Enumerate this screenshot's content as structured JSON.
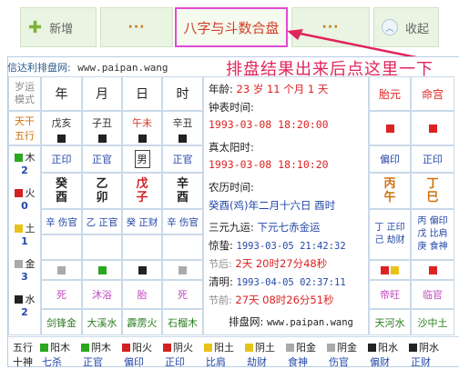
{
  "toolbar": {
    "add_label": "新增",
    "dots1": "···",
    "main_tab": "八字与斗数合盘",
    "dots2": "···",
    "fold_label": "收起"
  },
  "header": {
    "site_label": "信达利排盘网:",
    "site_url": "www.paipan.wang",
    "callout": "排盘结果出来后点这里一下"
  },
  "left_col": {
    "yunshi": "岁运模式",
    "tiangan": "天干",
    "wuxing": "五行",
    "elements": [
      {
        "name": "木",
        "count": "2",
        "color": "#2aa81f"
      },
      {
        "name": "火",
        "count": "0",
        "color": "#d22222"
      },
      {
        "name": "土",
        "count": "1",
        "color": "#e8c21a"
      },
      {
        "name": "金",
        "count": "3",
        "color": "#aaaaaa"
      },
      {
        "name": "水",
        "count": "2",
        "color": "#222222"
      }
    ]
  },
  "pillars": {
    "headers": [
      "年",
      "月",
      "日",
      "时"
    ],
    "sub": [
      "戊亥",
      "子丑",
      "午未",
      "辛丑"
    ],
    "sub_colors": [
      "#333333",
      "#333333",
      "#d63c27",
      "#333333"
    ],
    "gods": [
      "正印",
      "正官",
      "男",
      "正官"
    ],
    "stems": [
      "癸",
      "乙",
      "戊",
      "辛"
    ],
    "branches": [
      "酉",
      "卯",
      "子",
      "酉"
    ],
    "stem_colors": [
      "#222222",
      "#222222",
      "#d22222",
      "#222222"
    ],
    "hidden": [
      "辛 伤官",
      "乙 正官",
      "癸 正财",
      "辛 伤官"
    ],
    "states": [
      "死",
      "沐浴",
      "胎",
      "死"
    ],
    "nayin": [
      "剑锋金",
      "大溪水",
      "霹雳火",
      "石榴木"
    ]
  },
  "middle": {
    "age_label": "年龄:",
    "age_value": "23 岁 11 个月 1 天",
    "clock_label": "钟表时间:",
    "clock_value": "1993-03-08 18:20:00",
    "solar_label": "真太阳时:",
    "solar_value": "1993-03-08 18:10:20",
    "lunar_label": "农历时间:",
    "lunar_value": "癸酉(鸡)年二月十六日 酉时",
    "sanyuan_label": "三元九运:",
    "sanyuan_value": "下元七赤金运",
    "jingzhe_label": "惊蛰:",
    "jingzhe_value": "1993-03-05 21:42:32",
    "before_label": "节后:",
    "before_value": "2天 20时27分48秒",
    "qingming_label": "清明:",
    "qingming_value": "1993-04-05 02:37:11",
    "after_label": "节前:",
    "after_value": "27天 08时26分51秒",
    "footer_label": "排盘网:",
    "footer_url": "www.paipan.wang"
  },
  "right_col": {
    "headers": [
      "胎元",
      "命宫"
    ],
    "gods": [
      "偏印",
      "正印"
    ],
    "stems": [
      "丙",
      "丁"
    ],
    "branches": [
      "午",
      "巳"
    ],
    "hidden_a": [
      "丁 正印",
      "己 劫财"
    ],
    "hidden_b": [
      "丙 偏印",
      "戊 比肩",
      "庚 食神"
    ],
    "states": [
      "帝旺",
      "临官"
    ],
    "nayin": [
      "天河水",
      "沙中土"
    ]
  },
  "bottom": {
    "row1_label": "五行",
    "row2_label": "十神",
    "items": [
      {
        "el": "阳木",
        "god": "七杀",
        "color": "#2aa81f"
      },
      {
        "el": "阴木",
        "god": "正官",
        "color": "#2aa81f"
      },
      {
        "el": "阳火",
        "god": "偏印",
        "color": "#d22222"
      },
      {
        "el": "阴火",
        "god": "正印",
        "color": "#d22222"
      },
      {
        "el": "阳土",
        "god": "比肩",
        "color": "#e8c21a"
      },
      {
        "el": "阴土",
        "god": "劫财",
        "color": "#e8c21a"
      },
      {
        "el": "阳金",
        "god": "食神",
        "color": "#aaaaaa"
      },
      {
        "el": "阴金",
        "god": "伤官",
        "color": "#aaaaaa"
      },
      {
        "el": "阳水",
        "god": "偏财",
        "color": "#222222"
      },
      {
        "el": "阴水",
        "god": "正财",
        "color": "#222222"
      }
    ]
  }
}
